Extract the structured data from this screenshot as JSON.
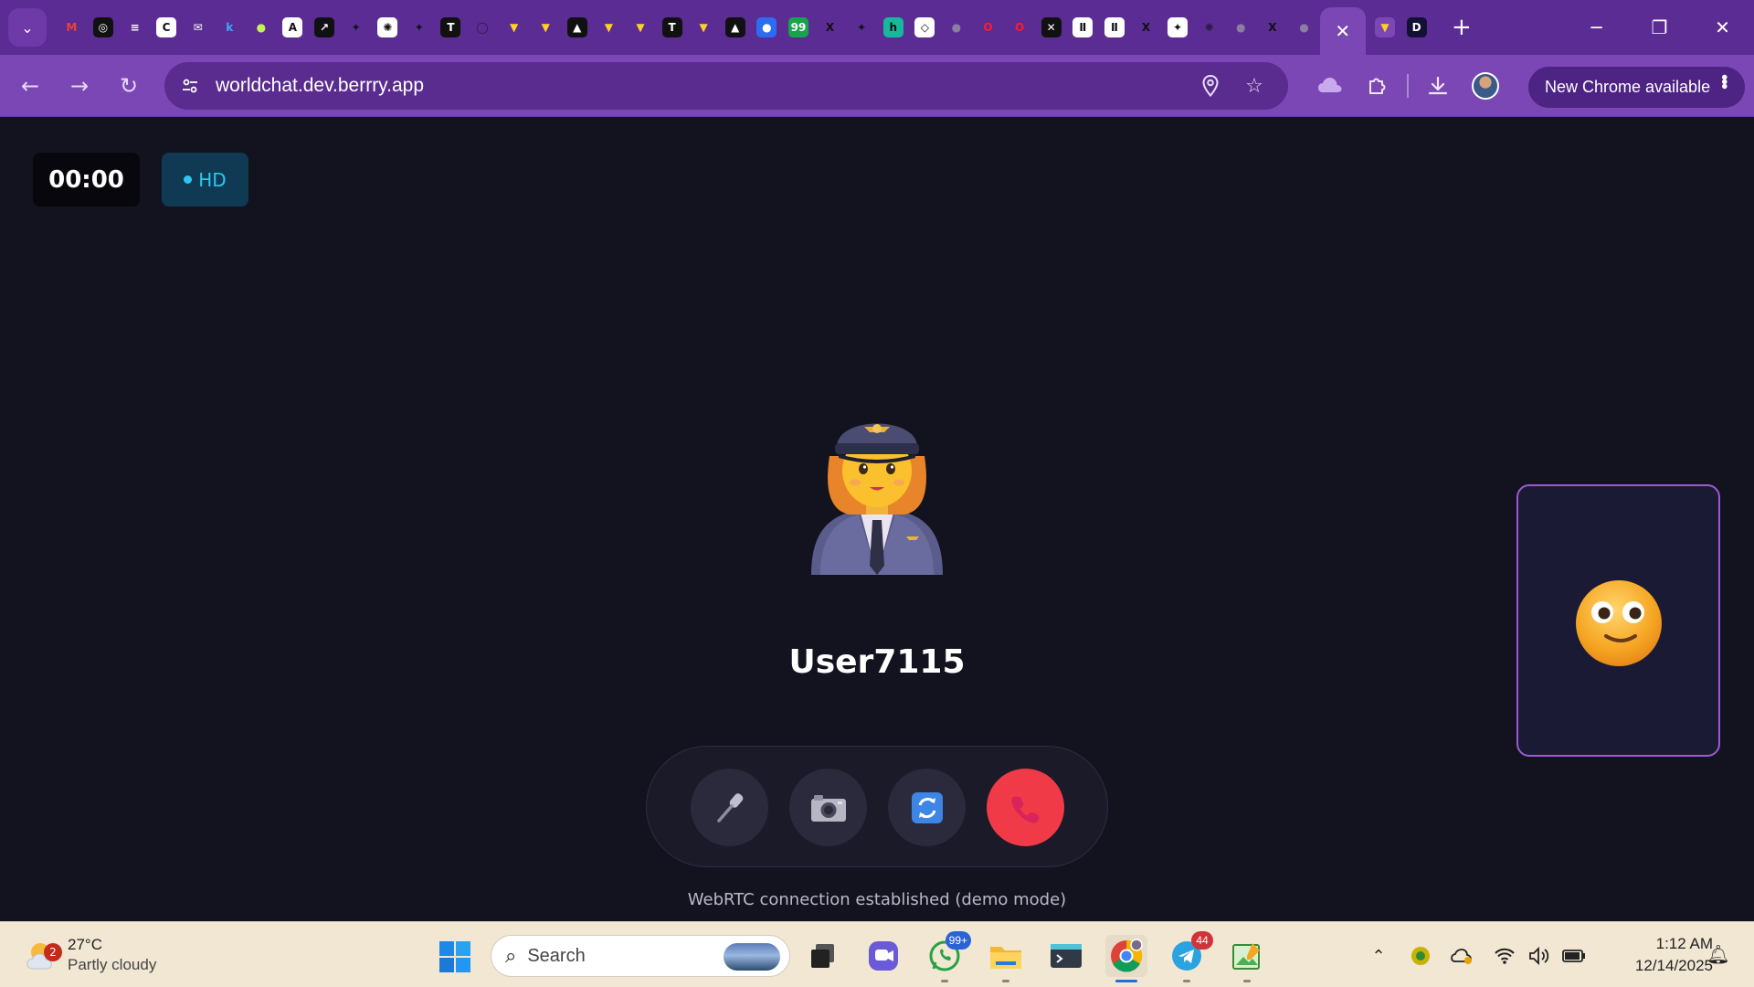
{
  "browser": {
    "tab_favicons": [
      {
        "name": "gmail",
        "glyph": "M",
        "bg": "#5b2c93",
        "fg": "#ea4335"
      },
      {
        "name": "app-logo",
        "glyph": "◎",
        "bg": "#111111",
        "fg": "#ffffff"
      },
      {
        "name": "menu-doc",
        "glyph": "≡",
        "bg": "#5b2c93",
        "fg": "#ffffff"
      },
      {
        "name": "c-app",
        "glyph": "C",
        "bg": "#ffffff",
        "fg": "#111111"
      },
      {
        "name": "mail-app",
        "glyph": "✉",
        "bg": "#5b2c93",
        "fg": "#ffffff"
      },
      {
        "name": "k-app",
        "glyph": "k",
        "bg": "#5b2c93",
        "fg": "#3fa9f5"
      },
      {
        "name": "lime-dot",
        "glyph": "●",
        "bg": "#5b2c93",
        "fg": "#c7ef5a"
      },
      {
        "name": "a-app",
        "glyph": "A",
        "bg": "#ffffff",
        "fg": "#111111"
      },
      {
        "name": "export-app",
        "glyph": "↗",
        "bg": "#111111",
        "fg": "#ffffff"
      },
      {
        "name": "gemini",
        "glyph": "✦",
        "bg": "#5b2c93",
        "fg": "#111111"
      },
      {
        "name": "openai",
        "glyph": "✺",
        "bg": "#ffffff",
        "fg": "#111111"
      },
      {
        "name": "gemini-2",
        "glyph": "✦",
        "bg": "#5b2c93",
        "fg": "#111111"
      },
      {
        "name": "t-app",
        "glyph": "T",
        "bg": "#111111",
        "fg": "#ffffff"
      },
      {
        "name": "github",
        "glyph": "◯",
        "bg": "#5b2c93",
        "fg": "#2a1a40"
      },
      {
        "name": "vite-1",
        "glyph": "▼",
        "bg": "#5b2c93",
        "fg": "#ffd028"
      },
      {
        "name": "vite-2",
        "glyph": "▼",
        "bg": "#5b2c93",
        "fg": "#ffd028"
      },
      {
        "name": "delta",
        "glyph": "▲",
        "bg": "#111111",
        "fg": "#ffffff"
      },
      {
        "name": "vite-3",
        "glyph": "▼",
        "bg": "#5b2c93",
        "fg": "#ffd028"
      },
      {
        "name": "vite-4",
        "glyph": "▼",
        "bg": "#5b2c93",
        "fg": "#ffd028"
      },
      {
        "name": "t-app-2",
        "glyph": "T",
        "bg": "#111111",
        "fg": "#ffffff"
      },
      {
        "name": "vite-5",
        "glyph": "▼",
        "bg": "#5b2c93",
        "fg": "#ffd028"
      },
      {
        "name": "delta-2",
        "glyph": "▲",
        "bg": "#111111",
        "fg": "#ffffff"
      },
      {
        "name": "c-circle",
        "glyph": "●",
        "bg": "#2d6cf0",
        "fg": "#ffffff"
      },
      {
        "name": "badge-app",
        "glyph": "99",
        "bg": "#19a34a",
        "fg": "#ffffff"
      },
      {
        "name": "x-1",
        "glyph": "X",
        "bg": "#5b2c93",
        "fg": "#111111"
      },
      {
        "name": "gemini-3",
        "glyph": "✦",
        "bg": "#5b2c93",
        "fg": "#111111"
      },
      {
        "name": "h-app",
        "glyph": "h",
        "bg": "#17b99a",
        "fg": "#111111"
      },
      {
        "name": "chevron-app",
        "glyph": "◇",
        "bg": "#ffffff",
        "fg": "#111111"
      },
      {
        "name": "grey-1",
        "glyph": "●",
        "bg": "#5b2c93",
        "fg": "#8a7fa0"
      },
      {
        "name": "opera-1",
        "glyph": "O",
        "bg": "#5b2c93",
        "fg": "#ff1b2d"
      },
      {
        "name": "opera-2",
        "glyph": "O",
        "bg": "#5b2c93",
        "fg": "#ff1b2d"
      },
      {
        "name": "x-2",
        "glyph": "✕",
        "bg": "#111111",
        "fg": "#ffffff"
      },
      {
        "name": "pause-1",
        "glyph": "Ⅱ",
        "bg": "#ffffff",
        "fg": "#111111"
      },
      {
        "name": "pause-2",
        "glyph": "Ⅱ",
        "bg": "#ffffff",
        "fg": "#111111"
      },
      {
        "name": "x-3",
        "glyph": "X",
        "bg": "#5b2c93",
        "fg": "#111111"
      },
      {
        "name": "sparkle",
        "glyph": "✦",
        "bg": "#ffffff",
        "fg": "#111111"
      },
      {
        "name": "openai-2",
        "glyph": "✺",
        "bg": "#5b2c93",
        "fg": "#2a1a40"
      },
      {
        "name": "grey-2",
        "glyph": "●",
        "bg": "#5b2c93",
        "fg": "#8a7fa0"
      },
      {
        "name": "x-4",
        "glyph": "X",
        "bg": "#5b2c93",
        "fg": "#111111"
      },
      {
        "name": "grey-3",
        "glyph": "●",
        "bg": "#5b2c93",
        "fg": "#8a7fa0"
      }
    ],
    "after_tab_favicons": [
      {
        "name": "vite-6",
        "glyph": "▼",
        "bg": "#7b47b5",
        "fg": "#ffd028"
      },
      {
        "name": "d-app",
        "glyph": "D",
        "bg": "#111133",
        "fg": "#ffffff"
      }
    ],
    "url": "worldchat.dev.berrry.app",
    "update_label": "New Chrome available"
  },
  "call": {
    "timer": "00:00",
    "quality_badge": "HD",
    "remote_user_name": "User7115",
    "status_message": "WebRTC connection established (demo mode)",
    "colors": {
      "background": "#13121f",
      "accent": "#9b5bd0",
      "end_call": "#f03a47",
      "hd": "#2fc6f3"
    }
  },
  "taskbar": {
    "weather_badge": "2",
    "weather_temp": "27°C",
    "weather_condition": "Partly cloudy",
    "search_placeholder": "Search",
    "whatsapp_badge": "99+",
    "telegram_badge": "44",
    "time": "1:12 AM",
    "date": "12/14/2025"
  }
}
